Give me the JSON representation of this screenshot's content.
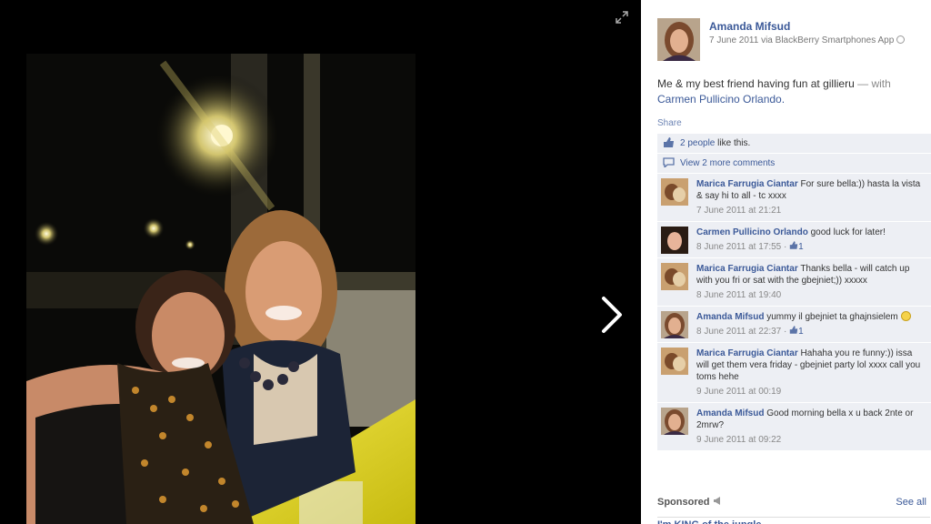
{
  "post": {
    "author": "Amanda Mifsud",
    "meta": "7 June 2011 via BlackBerry Smartphones App",
    "text": "Me & my best friend having fun at gillieru",
    "with_label": "— with",
    "tagged": "Carmen Pullicino Orlando.",
    "share_label": "Share",
    "likes_count": "2 people",
    "likes_suffix": "like this.",
    "more_comments": "View 2 more comments"
  },
  "comments": [
    {
      "author": "Marica Farrugia Ciantar",
      "text": "For sure bella:)) hasta la vista & say hi to all - tc xxxx",
      "time": "7 June 2011 at 21:21",
      "likes": ""
    },
    {
      "author": "Carmen Pullicino Orlando",
      "text": "good luck for later!",
      "time": "8 June 2011 at 17:55 ·",
      "likes": "1"
    },
    {
      "author": "Marica Farrugia Ciantar",
      "text": "Thanks bella - will catch up with you fri or sat with the gbejniet;)) xxxxx",
      "time": "8 June 2011 at 19:40",
      "likes": ""
    },
    {
      "author": "Amanda Mifsud",
      "text": "yummy il gbejniet ta ghajnsielem",
      "time": "8 June 2011 at 22:37 ·",
      "likes": "1"
    },
    {
      "author": "Marica Farrugia Ciantar",
      "text": "Hahaha you re funny:)) issa will get them vera friday - gbejniet party lol xxxx call you toms hehe",
      "time": "9 June 2011 at 00:19",
      "likes": ""
    },
    {
      "author": "Amanda Mifsud",
      "text": "Good morning bella x u back 2nte or 2mrw?",
      "time": "9 June 2011 at 09:22",
      "likes": ""
    }
  ],
  "sidebar": {
    "sponsored_label": "Sponsored",
    "see_all": "See all",
    "ad_title": "I'm KING of the jungle"
  },
  "icons": {
    "expand": "expand-icon",
    "next": "chevron-right-icon",
    "like": "thumbs-up-icon",
    "comment": "comment-bubble-icon",
    "globe": "globe-icon",
    "sponsored": "megaphone-icon"
  },
  "colors": {
    "link": "#3b5998",
    "ufi_bg": "#edeff4",
    "stage_bg": "#000000",
    "table_yellow": "#e3d81e"
  }
}
